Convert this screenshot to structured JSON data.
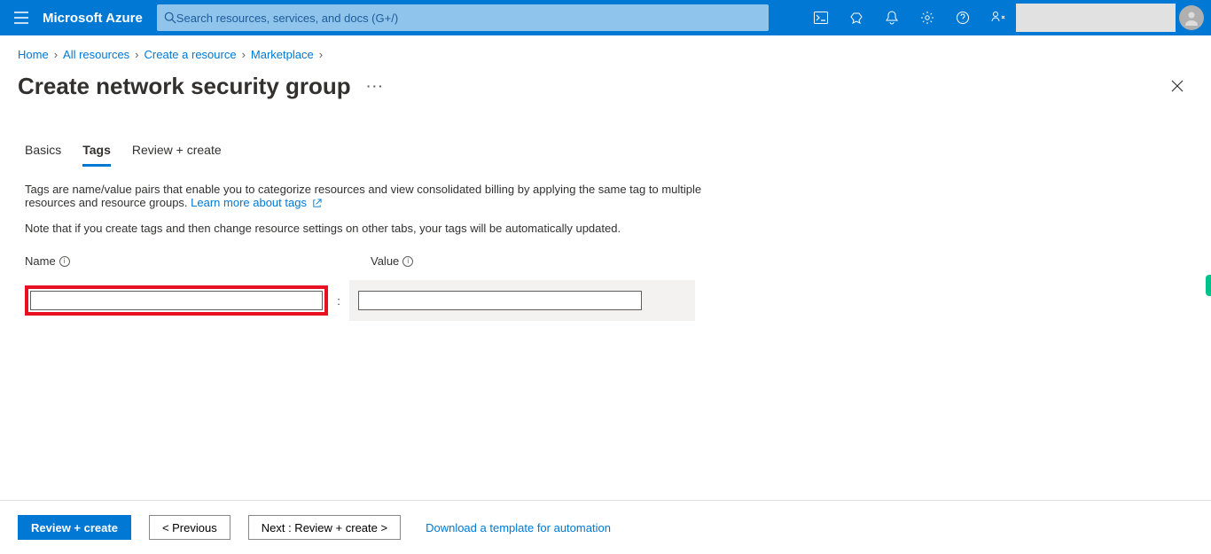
{
  "brand": "Microsoft Azure",
  "search": {
    "placeholder": "Search resources, services, and docs (G+/)"
  },
  "breadcrumb": {
    "items": [
      "Home",
      "All resources",
      "Create a resource",
      "Marketplace"
    ]
  },
  "page": {
    "title": "Create network security group",
    "more": "…"
  },
  "tabs": {
    "basics": "Basics",
    "tags": "Tags",
    "review": "Review + create",
    "active": "tags"
  },
  "body": {
    "intro": "Tags are name/value pairs that enable you to categorize resources and view consolidated billing by applying the same tag to multiple resources and resource groups. ",
    "learn_link": "Learn more about tags",
    "note": "Note that if you create tags and then change resource settings on other tabs, your tags will be automatically updated."
  },
  "tags_table": {
    "name_label": "Name",
    "value_label": "Value",
    "name_value": "",
    "value_value": ""
  },
  "footer": {
    "review": "Review + create",
    "prev": "<  Previous",
    "next": "Next : Review + create  >",
    "download": "Download a template for automation"
  }
}
